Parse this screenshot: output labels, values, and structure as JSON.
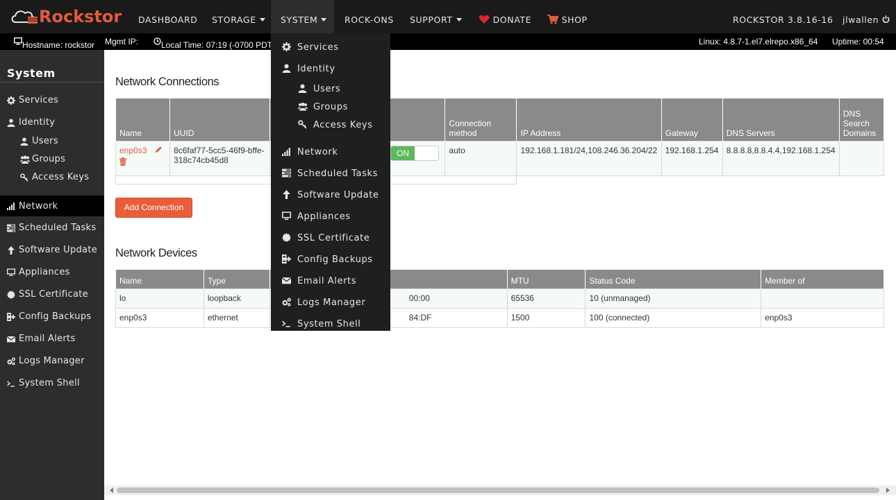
{
  "nav": {
    "brand": "Rockstor",
    "items": [
      "DASHBOARD",
      "STORAGE",
      "SYSTEM",
      "ROCK-ONS",
      "SUPPORT",
      "DONATE",
      "SHOP"
    ],
    "version": "ROCKSTOR 3.8.16-16",
    "user": "jlwallen"
  },
  "info": {
    "hostname": "Hostname: rockstor",
    "mgmt_ip": "Mgmt IP:",
    "local_time": "Local Time: 07:19 (-0700 PDT",
    "kernel": "Linux: 4.8.7-1.el7.elrepo.x86_64",
    "uptime": "Uptime: 00:54"
  },
  "sidebar": {
    "title": "System",
    "items": [
      {
        "label": "Services",
        "icon": "gear-icon"
      },
      {
        "label": "Identity",
        "icon": "user-icon"
      },
      {
        "label": "Users",
        "icon": "user-icon"
      },
      {
        "label": "Groups",
        "icon": "users-icon"
      },
      {
        "label": "Access Keys",
        "icon": "key-icon"
      },
      {
        "label": "Network",
        "icon": "signal-icon"
      },
      {
        "label": "Scheduled Tasks",
        "icon": "tasks-icon"
      },
      {
        "label": "Software Update",
        "icon": "arrow-up-icon"
      },
      {
        "label": "Appliances",
        "icon": "monitor-icon"
      },
      {
        "label": "SSL Certificate",
        "icon": "certificate-icon"
      },
      {
        "label": "Config Backups",
        "icon": "backup-icon"
      },
      {
        "label": "Email Alerts",
        "icon": "envelope-icon"
      },
      {
        "label": "Logs Manager",
        "icon": "cogs-icon"
      },
      {
        "label": "System Shell",
        "icon": "terminal-icon"
      }
    ]
  },
  "dropdown": {
    "items": [
      "Services",
      "Identity",
      "Users",
      "Groups",
      "Access Keys",
      "Network",
      "Scheduled Tasks",
      "Software Update",
      "Appliances",
      "SSL Certificate",
      "Config Backups",
      "Email Alerts",
      "Logs Manager",
      "System Shell"
    ]
  },
  "connections": {
    "title": "Network Connections",
    "headers": [
      "Name",
      "UUID",
      "",
      "",
      "Connection method",
      "IP Address",
      "Gateway",
      "DNS Servers",
      "DNS Search Domains"
    ],
    "row": {
      "name": "enp0s3",
      "uuid": "8c6faf77-5cc5-46f9-bffe-318c74cb45d8",
      "state": "activated",
      "toggle": "ON",
      "method": "auto",
      "ip": "192.168.1.181/24,108.246.36.204/22",
      "gateway": "192.168.1.254",
      "dns": "8.8.8.8,8.8.4.4,192.168.1.254",
      "search": ""
    },
    "add_button": "Add Connection"
  },
  "devices": {
    "title": "Network Devices",
    "headers": [
      "Name",
      "Type",
      "",
      "MTU",
      "Status Code",
      "Member of"
    ],
    "rows": [
      {
        "name": "lo",
        "type": "loopback",
        "mac": "00:00",
        "mtu": "65536",
        "status": "10 (unmanaged)",
        "member": ""
      },
      {
        "name": "enp0s3",
        "type": "ethernet",
        "mac": "84:DF",
        "mtu": "1500",
        "status": "100 (connected)",
        "member": "enp0s3"
      }
    ]
  },
  "colors": {
    "accent": "#e05b3c",
    "topbar": "#1a1a1a",
    "sidebar": "#2d2d2d",
    "toggle_on": "#5cb85c"
  }
}
